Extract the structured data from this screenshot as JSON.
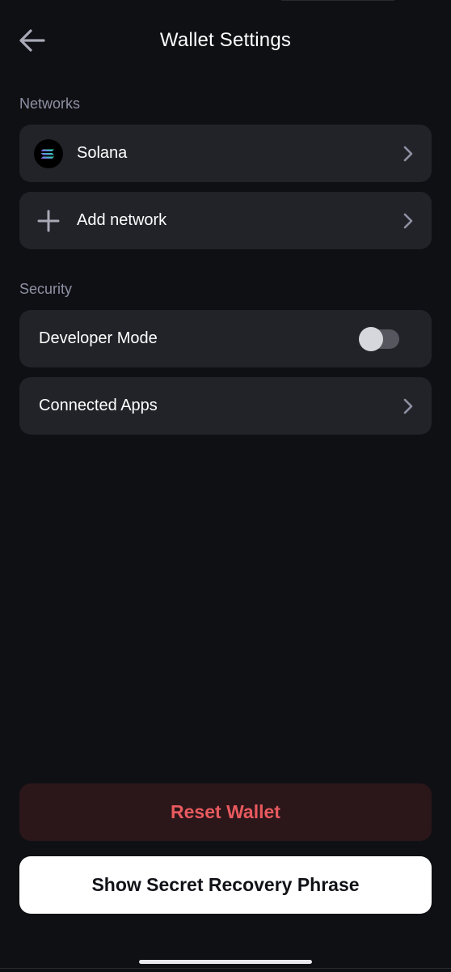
{
  "header": {
    "title": "Wallet Settings",
    "back_icon": "back-arrow-icon"
  },
  "networks": {
    "section_label": "Networks",
    "items": [
      {
        "label": "Solana",
        "icon": "solana-logo-icon",
        "trailing": "chevron-right-icon"
      },
      {
        "label": "Add network",
        "icon": "plus-icon",
        "trailing": "chevron-right-icon"
      }
    ]
  },
  "security": {
    "section_label": "Security",
    "developer_mode": {
      "label": "Developer Mode",
      "enabled": false
    },
    "connected_apps": {
      "label": "Connected Apps",
      "trailing": "chevron-right-icon"
    }
  },
  "actions": {
    "reset_label": "Reset Wallet",
    "recovery_label": "Show Secret Recovery Phrase"
  },
  "colors": {
    "background": "#0f1014",
    "card": "#222328",
    "muted_text": "#8e91a3",
    "danger_text": "#e85a5e",
    "danger_bg": "#2b161a"
  }
}
